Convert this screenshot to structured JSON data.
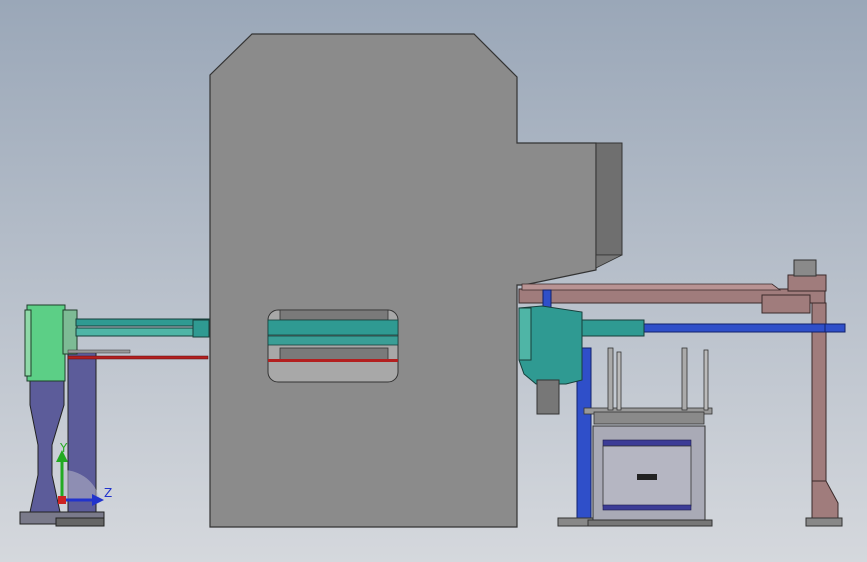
{
  "scene": {
    "background_top": "#9aa7b8",
    "background_bottom": "#d5d8dd",
    "colors": {
      "press": "#8b8b8b",
      "press_edge": "#333333",
      "press_dark": "#6f6f6f",
      "teal": "#2f9a92",
      "teal_light": "#4fb5a6",
      "green_box": "#5ccf86",
      "column_purple": "#5c5c9a",
      "blue": "#2f4fc9",
      "brown": "#a07c7c",
      "rail_red": "#b32020",
      "cabinet": "#a9aab6",
      "cabinet_band": "#3c3c96"
    }
  },
  "triad": {
    "y_label": "Y",
    "z_label": "Z",
    "y_color": "#22aa22",
    "z_color": "#2233cc",
    "x_color": "#cc2222"
  }
}
